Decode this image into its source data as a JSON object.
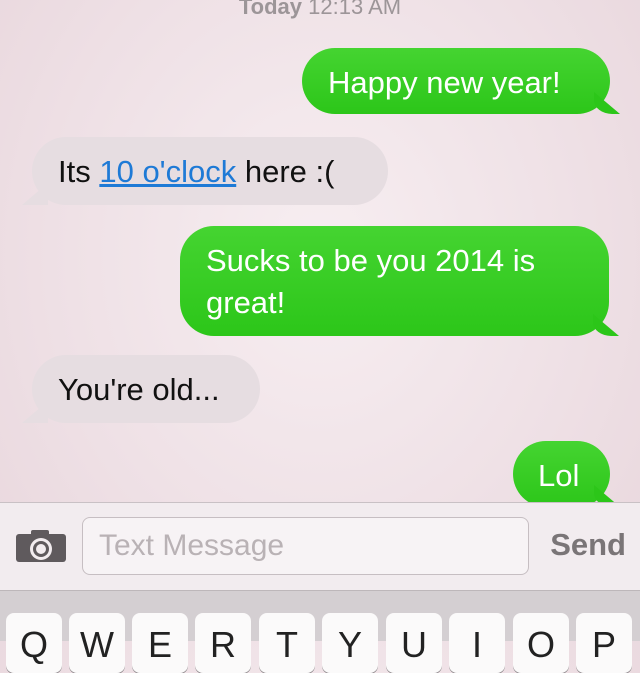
{
  "header": {
    "timestamp_day": "Today",
    "timestamp_time": "12:13 AM"
  },
  "messages": [
    {
      "direction": "outgoing",
      "text": "Happy new year!"
    },
    {
      "direction": "incoming",
      "text_before": "Its ",
      "link": "10 o'clock",
      "text_after": " here :("
    },
    {
      "direction": "outgoing",
      "line1": "Sucks to be you 2014 is",
      "line2": "great!"
    },
    {
      "direction": "incoming",
      "text": "You're old..."
    },
    {
      "direction": "outgoing",
      "text": "Lol"
    }
  ],
  "composer": {
    "placeholder": "Text Message",
    "send_label": "Send",
    "camera_icon": "camera-icon"
  },
  "keyboard": {
    "keys": [
      "Q",
      "W",
      "E",
      "R",
      "T",
      "Y",
      "U",
      "I",
      "O",
      "P"
    ]
  },
  "colors": {
    "outgoing_bubble": "#2cc619",
    "incoming_bubble": "#e6dde1",
    "link": "#1e7ad6"
  }
}
